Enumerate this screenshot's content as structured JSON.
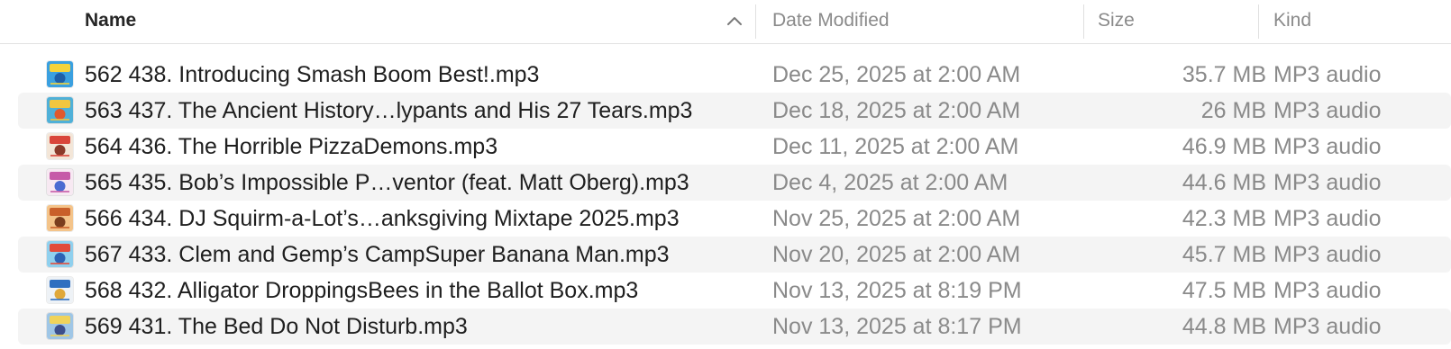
{
  "columns": {
    "name": "Name",
    "date": "Date Modified",
    "size": "Size",
    "kind": "Kind"
  },
  "sort": {
    "column": "name",
    "direction": "ascending",
    "icon": "chevron-up-icon"
  },
  "files": [
    {
      "name": "562 438. Introducing Smash Boom Best!.mp3",
      "date": "Dec 25, 2025 at 2:00 AM",
      "size": "35.7 MB",
      "kind": "MP3 audio",
      "thumb_colors": [
        "#3aa0e0",
        "#f5d33a",
        "#1e5fa8"
      ]
    },
    {
      "name": "563 437. The Ancient History…lypants and His 27 Tears.mp3",
      "date": "Dec 18, 2025 at 2:00 AM",
      "size": "26 MB",
      "kind": "MP3 audio",
      "thumb_colors": [
        "#4fb0d8",
        "#f2c640",
        "#e0592c"
      ]
    },
    {
      "name": "564 436. The Horrible PizzaDemons.mp3",
      "date": "Dec 11, 2025 at 2:00 AM",
      "size": "46.9 MB",
      "kind": "MP3 audio",
      "thumb_colors": [
        "#f3e6d8",
        "#d9453a",
        "#8a3a2a"
      ]
    },
    {
      "name": "565 435. Bob’s Impossible P…ventor (feat. Matt Oberg).mp3",
      "date": "Dec 4, 2025 at 2:00 AM",
      "size": "44.6 MB",
      "kind": "MP3 audio",
      "thumb_colors": [
        "#f7e9f2",
        "#c65aa8",
        "#4b6bd1"
      ]
    },
    {
      "name": "566 434. DJ Squirm-a-Lot’s…anksgiving Mixtape 2025.mp3",
      "date": "Nov 25, 2025 at 2:00 AM",
      "size": "42.3 MB",
      "kind": "MP3 audio",
      "thumb_colors": [
        "#f4c48a",
        "#c9602a",
        "#7a3e1e"
      ]
    },
    {
      "name": "567 433. Clem and Gemp’s CampSuper Banana Man.mp3",
      "date": "Nov 20, 2025 at 2:00 AM",
      "size": "45.7 MB",
      "kind": "MP3 audio",
      "thumb_colors": [
        "#8fd0ee",
        "#e24b3a",
        "#2c63b5"
      ]
    },
    {
      "name": "568 432. Alligator DroppingsBees in the Ballot Box.mp3",
      "date": "Nov 13, 2025 at 8:19 PM",
      "size": "47.5 MB",
      "kind": "MP3 audio",
      "thumb_colors": [
        "#eef2f6",
        "#2f6fc0",
        "#e0a83a"
      ]
    },
    {
      "name": "569 431. The Bed Do Not Disturb.mp3",
      "date": "Nov 13, 2025 at 8:17 PM",
      "size": "44.8 MB",
      "kind": "MP3 audio",
      "thumb_colors": [
        "#9fc6e6",
        "#f0d35a",
        "#3c4f8c"
      ]
    }
  ]
}
